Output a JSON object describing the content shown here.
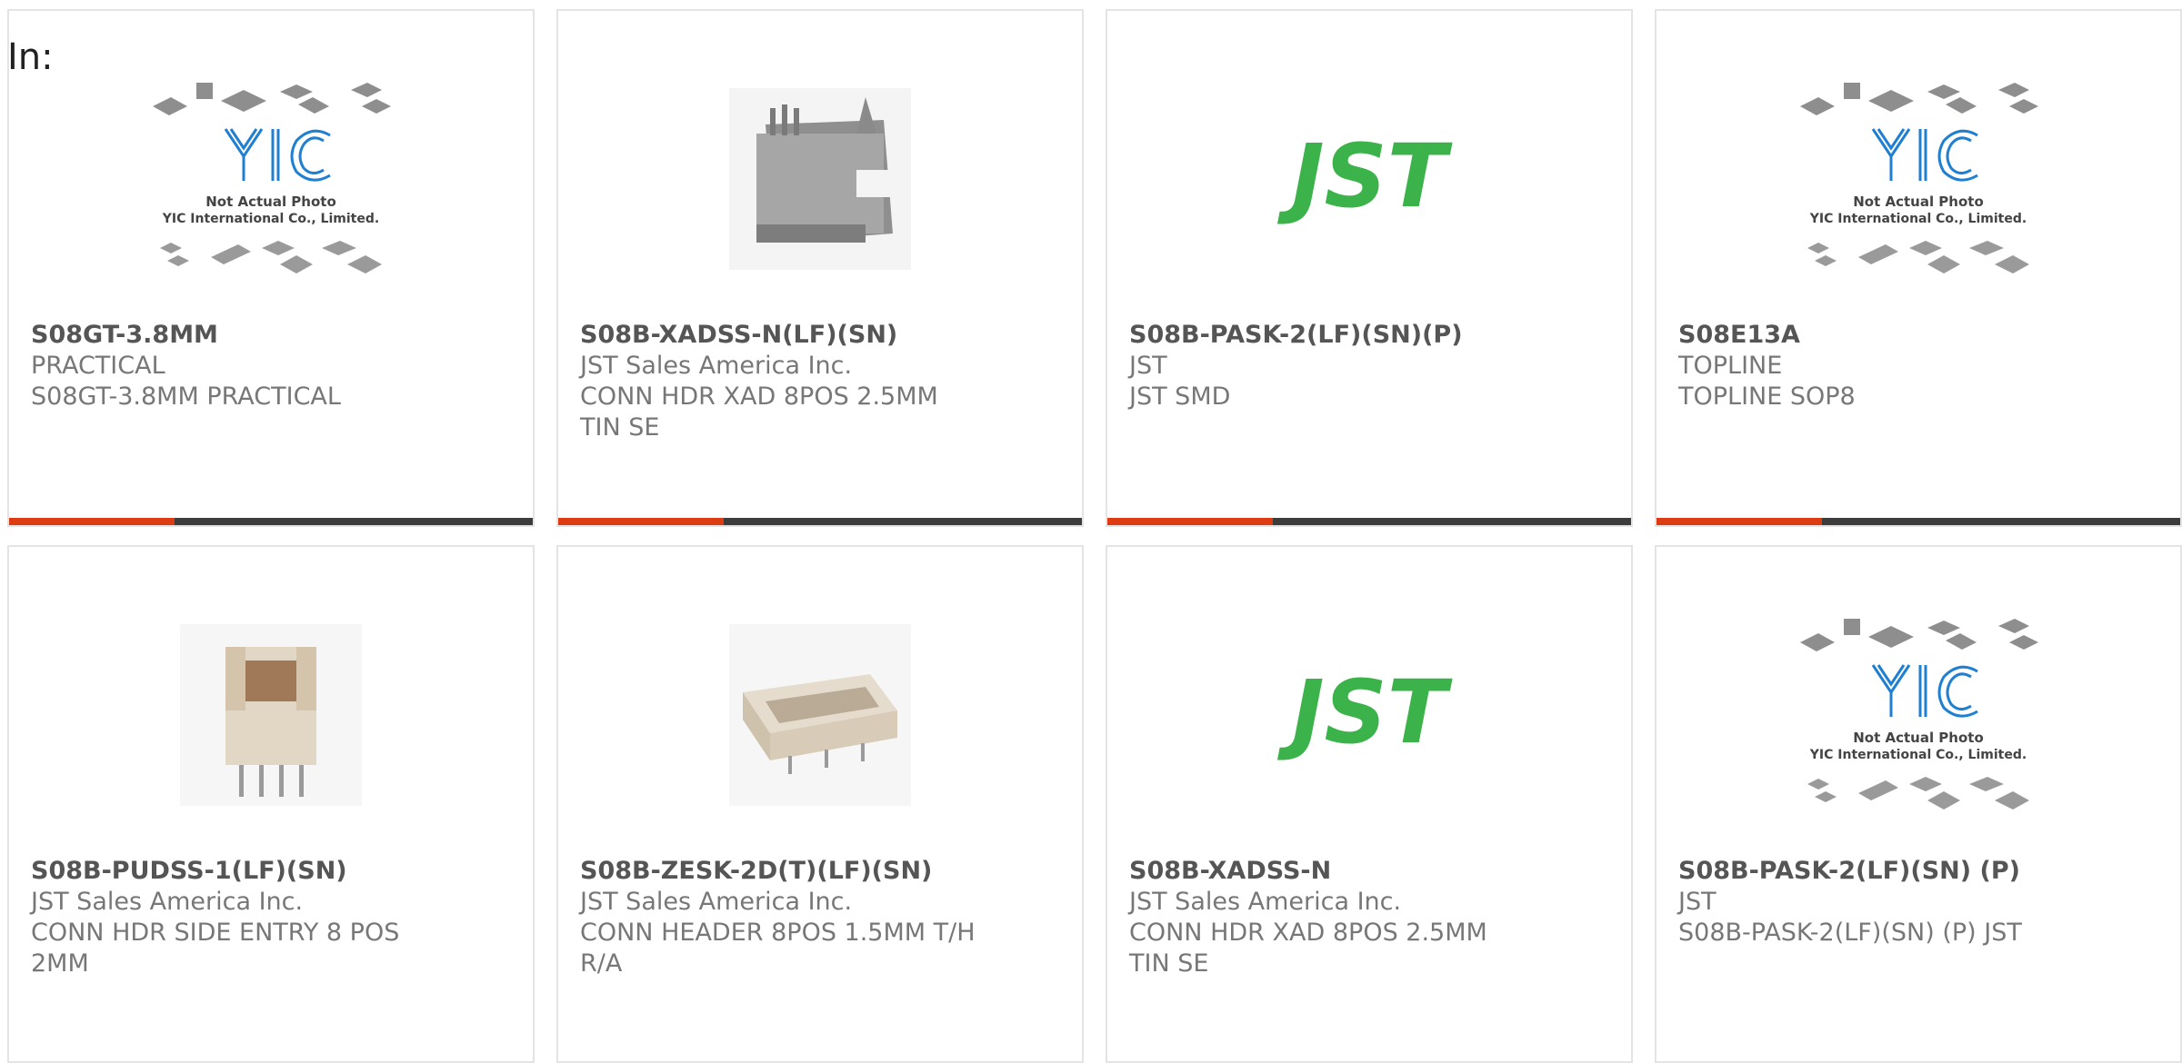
{
  "header": {
    "in_label": "In:"
  },
  "placeholder": {
    "line1": "Not Actual Photo",
    "line2": "YIC International Co., Limited.",
    "logo": "YIC"
  },
  "jst_logo": "JST",
  "colors": {
    "accent": "#dd3b12",
    "bar": "#3c3c3c",
    "jst_green": "#3bb34a",
    "yic_blue": "#1f7fd0"
  },
  "products": [
    {
      "part": "S08GT-3.8MM",
      "maker": "PRACTICAL",
      "desc": "S08GT-3.8MM PRACTICAL",
      "image": "yic-placeholder"
    },
    {
      "part": "S08B-XADSS-N(LF)(SN)",
      "maker": "JST Sales America Inc.",
      "desc": "CONN HDR XAD 8POS 2.5MM TIN SE",
      "image": "gray-connector"
    },
    {
      "part": "S08B-PASK-2(LF)(SN)(P)",
      "maker": "JST",
      "desc": "JST SMD",
      "image": "jst-logo"
    },
    {
      "part": "S08E13A",
      "maker": "TOPLINE",
      "desc": "TOPLINE SOP8",
      "image": "yic-placeholder"
    },
    {
      "part": "S08B-PUDSS-1(LF)(SN)",
      "maker": "JST Sales America Inc.",
      "desc": "CONN HDR SIDE ENTRY 8 POS 2MM",
      "image": "upright-connector"
    },
    {
      "part": "S08B-ZESK-2D(T)(LF)(SN)",
      "maker": "JST Sales America Inc.",
      "desc": "CONN HEADER 8POS 1.5MM T/H R/A",
      "image": "header-connector"
    },
    {
      "part": "S08B-XADSS-N",
      "maker": "JST Sales America Inc.",
      "desc": "CONN HDR XAD 8POS 2.5MM TIN SE",
      "image": "jst-logo"
    },
    {
      "part": "S08B-PASK-2(LF)(SN) (P)",
      "maker": "JST",
      "desc": "S08B-PASK-2(LF)(SN) (P) JST",
      "image": "yic-placeholder"
    }
  ]
}
